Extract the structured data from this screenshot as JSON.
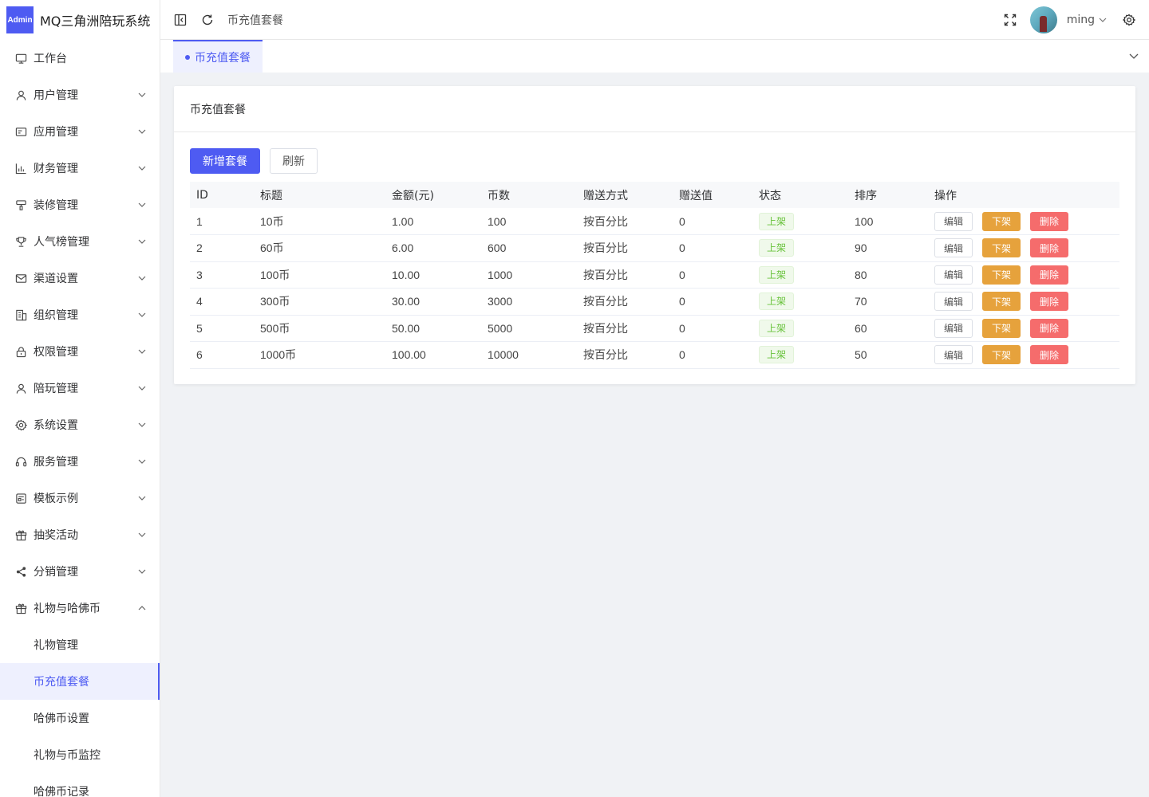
{
  "app": {
    "logo_badge": "Admin",
    "title": "MQ三角洲陪玩系统"
  },
  "sidebar": {
    "items": [
      {
        "label": "工作台",
        "icon": "monitor-icon",
        "expandable": false
      },
      {
        "label": "用户管理",
        "icon": "user-icon",
        "expandable": true
      },
      {
        "label": "应用管理",
        "icon": "app-card-icon",
        "expandable": true
      },
      {
        "label": "财务管理",
        "icon": "chart-icon",
        "expandable": true
      },
      {
        "label": "装修管理",
        "icon": "brush-icon",
        "expandable": true
      },
      {
        "label": "人气榜管理",
        "icon": "trophy-icon",
        "expandable": true
      },
      {
        "label": "渠道设置",
        "icon": "mail-icon",
        "expandable": true
      },
      {
        "label": "组织管理",
        "icon": "building-icon",
        "expandable": true
      },
      {
        "label": "权限管理",
        "icon": "lock-icon",
        "expandable": true
      },
      {
        "label": "陪玩管理",
        "icon": "person-icon",
        "expandable": true
      },
      {
        "label": "系统设置",
        "icon": "gear-icon",
        "expandable": true
      },
      {
        "label": "服务管理",
        "icon": "headset-icon",
        "expandable": true
      },
      {
        "label": "模板示例",
        "icon": "template-icon",
        "expandable": true
      },
      {
        "label": "抽奖活动",
        "icon": "gift-icon",
        "expandable": true
      },
      {
        "label": "分销管理",
        "icon": "share-icon",
        "expandable": true
      },
      {
        "label": "礼物与哈佛币",
        "icon": "gift-icon",
        "expandable": true,
        "expanded": true
      }
    ],
    "sub_items": [
      "礼物管理",
      "币充值套餐",
      "哈佛币设置",
      "礼物与币监控",
      "哈佛币记录"
    ],
    "active_sub": "币充值套餐"
  },
  "header": {
    "breadcrumb": "币充值套餐",
    "username": "ming"
  },
  "tabs": [
    {
      "label": "币充值套餐",
      "active": true
    }
  ],
  "card": {
    "title": "币充值套餐",
    "add_button": "新增套餐",
    "refresh_button": "刷新",
    "columns": [
      "ID",
      "标题",
      "金额(元)",
      "币数",
      "赠送方式",
      "赠送值",
      "状态",
      "排序",
      "操作"
    ],
    "rows": [
      {
        "id": "1",
        "title": "10币",
        "amount": "1.00",
        "coins": "100",
        "gift_mode": "按百分比",
        "gift_value": "0",
        "status": "上架",
        "sort": "100"
      },
      {
        "id": "2",
        "title": "60币",
        "amount": "6.00",
        "coins": "600",
        "gift_mode": "按百分比",
        "gift_value": "0",
        "status": "上架",
        "sort": "90"
      },
      {
        "id": "3",
        "title": "100币",
        "amount": "10.00",
        "coins": "1000",
        "gift_mode": "按百分比",
        "gift_value": "0",
        "status": "上架",
        "sort": "80"
      },
      {
        "id": "4",
        "title": "300币",
        "amount": "30.00",
        "coins": "3000",
        "gift_mode": "按百分比",
        "gift_value": "0",
        "status": "上架",
        "sort": "70"
      },
      {
        "id": "5",
        "title": "500币",
        "amount": "50.00",
        "coins": "5000",
        "gift_mode": "按百分比",
        "gift_value": "0",
        "status": "上架",
        "sort": "60"
      },
      {
        "id": "6",
        "title": "1000币",
        "amount": "100.00",
        "coins": "10000",
        "gift_mode": "按百分比",
        "gift_value": "0",
        "status": "上架",
        "sort": "50"
      }
    ],
    "actions": {
      "edit": "编辑",
      "off": "下架",
      "delete": "删除"
    }
  },
  "colors": {
    "primary": "#4e5bf2",
    "warning": "#e6a23c",
    "danger": "#f56c6c",
    "success": "#67c23a"
  }
}
